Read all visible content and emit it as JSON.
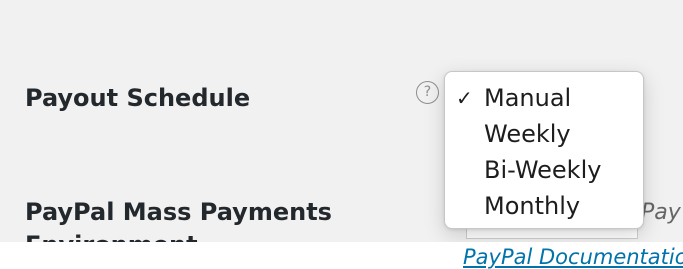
{
  "settings": {
    "payout_schedule_label": "Payout Schedule",
    "paypal_environment_label_line1": "PayPal Mass Payments",
    "paypal_environment_label_line2": "Environment"
  },
  "help": {
    "icon": "help-circle-icon",
    "glyph": "?"
  },
  "dropdown": {
    "selected_index": 0,
    "check_glyph": "✓",
    "options": [
      "Manual",
      "Weekly",
      "Bi-Weekly",
      "Monthly"
    ]
  },
  "paypal": {
    "side_text": "Pay",
    "documentation_link": "PayPal Documentatio"
  },
  "colors": {
    "panel_background": "#f1f1f1",
    "label_text": "#23282d",
    "link": "#0073aa",
    "menu_background": "#ffffff"
  }
}
